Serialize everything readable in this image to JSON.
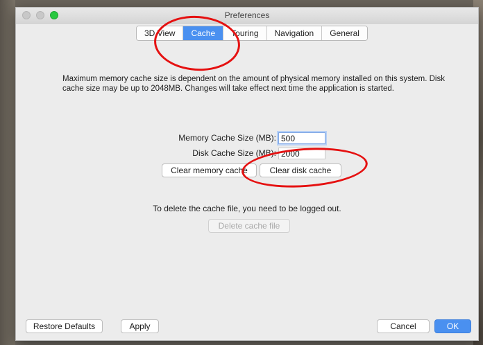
{
  "window": {
    "title": "Preferences"
  },
  "tabs": [
    {
      "label": "3D View",
      "active": false
    },
    {
      "label": "Cache",
      "active": true
    },
    {
      "label": "Touring",
      "active": false
    },
    {
      "label": "Navigation",
      "active": false
    },
    {
      "label": "General",
      "active": false
    }
  ],
  "cache": {
    "description": "Maximum memory cache size is dependent on the amount of physical memory installed on this system. Disk cache size may be up to 2048MB. Changes will take effect next time the application is started.",
    "memory_label": "Memory Cache Size (MB):",
    "memory_value": "500",
    "disk_label": "Disk Cache Size (MB):",
    "disk_value": "2000",
    "clear_memory_label": "Clear memory cache",
    "clear_disk_label": "Clear disk cache",
    "delete_info": "To delete the cache file, you need to be logged out.",
    "delete_label": "Delete cache file"
  },
  "footer": {
    "restore_label": "Restore Defaults",
    "apply_label": "Apply",
    "cancel_label": "Cancel",
    "ok_label": "OK"
  },
  "colors": {
    "accent": "#4a90f0",
    "annotation": "#e51111",
    "zoom_light": "#28c840"
  }
}
